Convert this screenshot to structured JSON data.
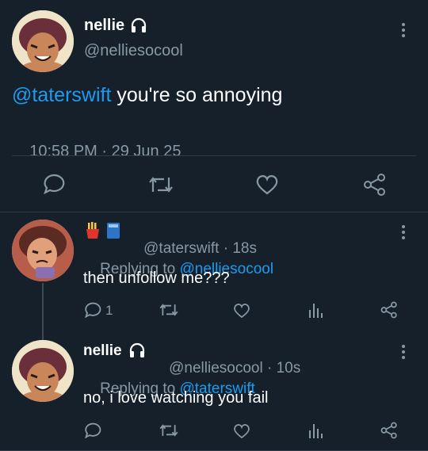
{
  "main_tweet": {
    "author_name": "nellie",
    "author_handle": "@nelliesocool",
    "mention": "@taterswift",
    "text": " you're so annoying",
    "time": "10:58 PM",
    "separator": " · ",
    "date": "29 Jun 25"
  },
  "replies": [
    {
      "emoji_badges": [
        "french-fries",
        "blue-book"
      ],
      "author_handle": "@taterswift",
      "age": "18s",
      "replying_label": "Replying to ",
      "replying_to": "@nelliesocool",
      "text": "then unfollow me???",
      "reply_count": "1"
    },
    {
      "author_name": "nellie",
      "author_handle": "@nelliesocool",
      "age": "10s",
      "replying_label": "Replying to ",
      "replying_to": "@taterswift",
      "text": "no, i love watching you fail",
      "reply_count": ""
    }
  ],
  "separator": " · ",
  "colors": {
    "background": "#15202b",
    "accent": "#1d9bf0",
    "muted": "#8899a6",
    "divider": "#2f3b47"
  },
  "icons": [
    "headphones-icon",
    "more-icon",
    "reply-icon",
    "retweet-icon",
    "like-icon",
    "share-icon",
    "analytics-icon"
  ]
}
